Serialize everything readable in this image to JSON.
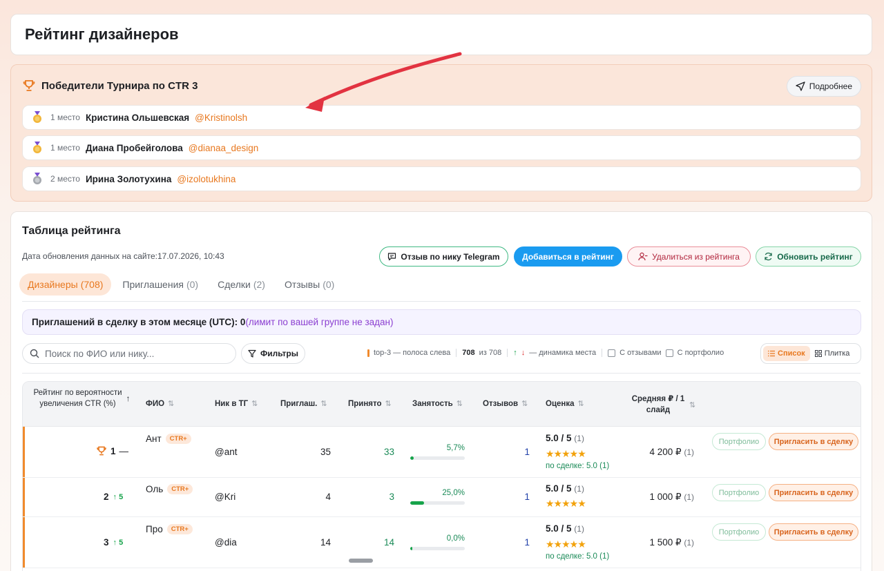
{
  "page": {
    "title": "Рейтинг дизайнеров"
  },
  "winners": {
    "title": "Победители Турнира по CTR 3",
    "more_label": "Подробнее",
    "items": [
      {
        "place": "1 место",
        "name": "Кристина Ольшевская",
        "tg": "@Kristinolsh",
        "medal": "gold-medal-icon"
      },
      {
        "place": "1 место",
        "name": "Диана Пробейголова",
        "tg": "@dianaa_design",
        "medal": "gold-medal-icon"
      },
      {
        "place": "2 место",
        "name": "Ирина Золотухина",
        "tg": "@izolotukhina",
        "medal": "silver-medal-icon"
      }
    ]
  },
  "table": {
    "title": "Таблица рейтинга",
    "updated_label": "Дата обновления данных на сайте:",
    "updated_value": "17.07.2026, 10:43",
    "buttons": {
      "review": "Отзыв по нику Telegram",
      "add": "Добавиться в рейтинг",
      "remove": "Удалиться из рейтинга",
      "refresh": "Обновить рейтинг"
    },
    "tabs": [
      {
        "label": "Дизайнеры",
        "count": "(708)"
      },
      {
        "label": "Приглашения",
        "count": "(0)"
      },
      {
        "label": "Сделки",
        "count": "(2)"
      },
      {
        "label": "Отзывы",
        "count": "(0)"
      }
    ],
    "limit_text": "Приглашений в сделку в этом месяце (UTC): 0",
    "limit_note": "(лимит по вашей группе не задан)",
    "search_placeholder": "Поиск по ФИО или нику...",
    "filters_label": "Фильтры",
    "legend": {
      "top3": "top-3 — полоса слева",
      "shown": "708",
      "of": "из 708",
      "dynamics": "— динамика места",
      "with_reviews": "С отзывами",
      "with_portfolio": "С портфолио"
    },
    "view": {
      "list": "Список",
      "tiles": "Плитка"
    },
    "columns": {
      "rating": "Рейтинг по вероятности увеличения CTR (%)",
      "name": "ФИО",
      "nick": "Ник в ТГ",
      "invites": "Приглаш.",
      "accepted": "Принято",
      "busy": "Занятость",
      "reviews": "Отзывов",
      "score": "Оценка",
      "avg": "Средняя ₽ / 1 слайд"
    },
    "rows": [
      {
        "rank": "1",
        "dyn": "—",
        "name": "Ант",
        "badge": "CTR+",
        "nick": "@ant",
        "invites": "35",
        "accepted": "33",
        "busy": "5,7%",
        "busy_fraction": 0.057,
        "reviews": "1",
        "score": "5.0 / 5",
        "score_count": "(1)",
        "stars": "★★★★★",
        "deal": "по сделке: 5.0 (1)",
        "avg": "4 200 ₽",
        "avg_count": "(1)",
        "portfolio": "Портфолио",
        "invite": "Пригласить в сделку"
      },
      {
        "rank": "2",
        "dyn": "↑ 5",
        "name": "Оль",
        "badge": "CTR+",
        "nick": "@Kri",
        "invites": "4",
        "accepted": "3",
        "busy": "25,0%",
        "busy_fraction": 0.25,
        "reviews": "1",
        "score": "5.0 / 5",
        "score_count": "(1)",
        "stars": "★★★★★",
        "deal": "",
        "avg": "1 000 ₽",
        "avg_count": "(1)",
        "portfolio": "Портфолио",
        "invite": "Пригласить в сделку"
      },
      {
        "rank": "3",
        "dyn": "↑ 5",
        "name": "Про",
        "badge": "CTR+",
        "nick": "@dia",
        "invites": "14",
        "accepted": "14",
        "busy": "0,0%",
        "busy_fraction": 0.0,
        "reviews": "1",
        "score": "5.0 / 5",
        "score_count": "(1)",
        "stars": "★★★★★",
        "deal": "по сделке: 5.0 (1)",
        "avg": "1 500 ₽",
        "avg_count": "(1)",
        "portfolio": "Портфолио",
        "invite": "Пригласить в сделку"
      }
    ]
  },
  "colors": {
    "accent": "#e8781f",
    "primary": "#1a9bf0",
    "success": "#16a34a",
    "danger": "#b1263d"
  }
}
